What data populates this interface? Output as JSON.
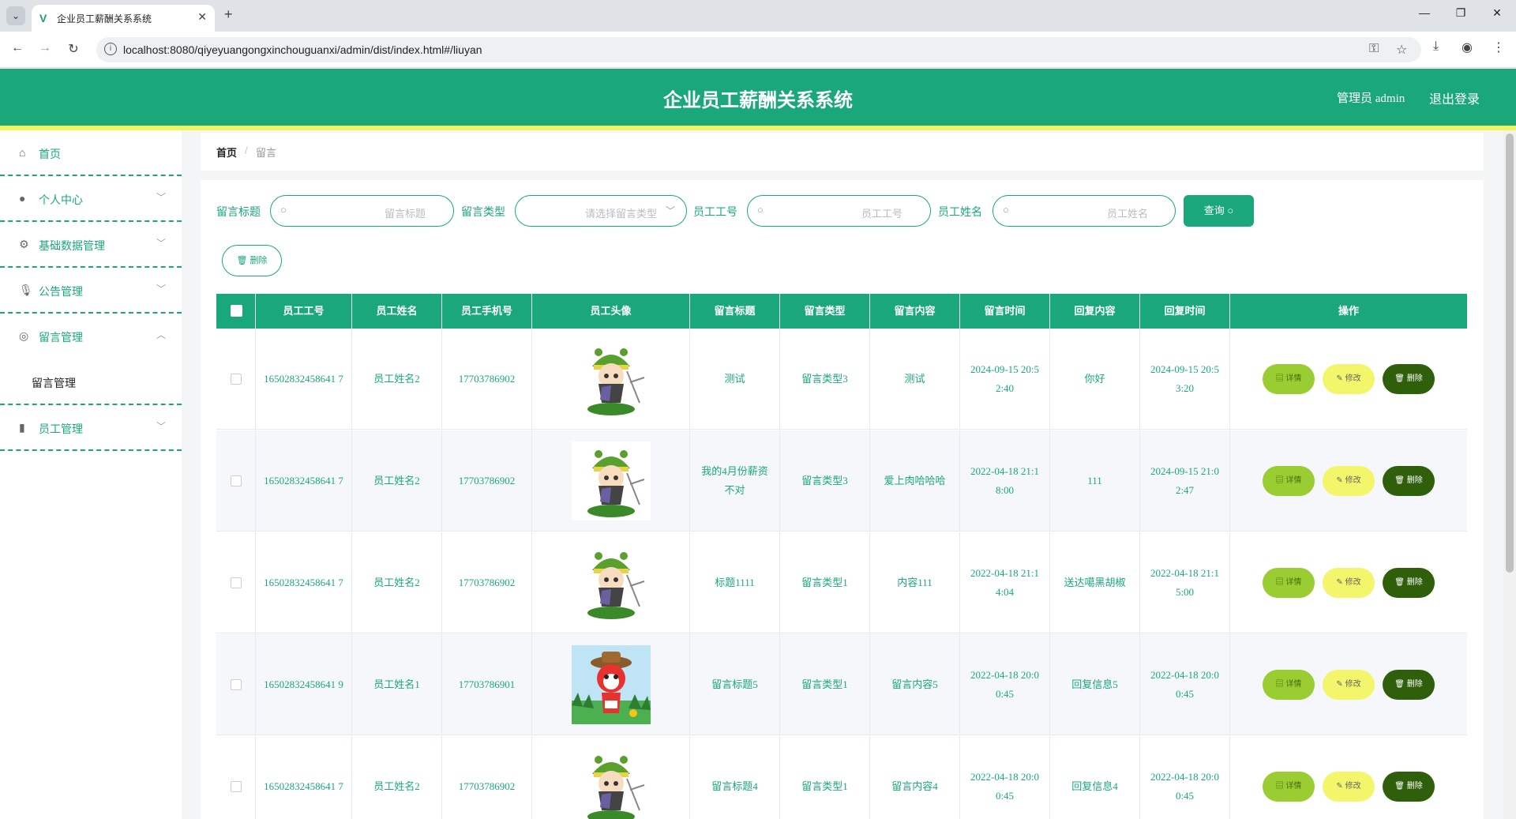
{
  "browser": {
    "tab_title": "企业员工薪酬关系系统",
    "url": "localhost:8080/qiyeyuangongxinchouguanxi/admin/dist/index.html#/liuyan"
  },
  "header": {
    "title": "企业员工薪酬关系系统",
    "user": "管理员 admin",
    "logout": "退出登录"
  },
  "sidebar": {
    "items": [
      {
        "label": "首页",
        "icon": "home-icon"
      },
      {
        "label": "个人中心",
        "icon": "user-icon"
      },
      {
        "label": "基础数据管理",
        "icon": "settings-icon"
      },
      {
        "label": "公告管理",
        "icon": "microphone-icon"
      },
      {
        "label": "留言管理",
        "icon": "compass-icon"
      },
      {
        "label": "员工管理",
        "icon": "bar-chart-icon"
      }
    ],
    "sub_item": "留言管理"
  },
  "breadcrumb": {
    "home": "首页",
    "sep": "/",
    "current": "留言"
  },
  "filters": {
    "title_label": "留言标题",
    "title_ph": "留言标题",
    "type_label": "留言类型",
    "type_ph": "请选择留言类型",
    "no_label": "员工工号",
    "no_ph": "员工工号",
    "name_label": "员工姓名",
    "name_ph": "员工姓名",
    "query": "查询",
    "delete": "删除"
  },
  "table": {
    "headers": [
      "员工工号",
      "员工姓名",
      "员工手机号",
      "员工头像",
      "留言标题",
      "留言类型",
      "留言内容",
      "留言时间",
      "回复内容",
      "回复时间",
      "操作"
    ],
    "actions": {
      "detail": "详情",
      "edit": "修改",
      "delete": "删除"
    },
    "rows": [
      {
        "no": "16502832458641 7",
        "name": "员工姓名2",
        "phone": "17703786902",
        "avatar": "green",
        "title": "测试",
        "type": "留言类型3",
        "content": "测试",
        "time": "2024-09-15 20:52:40",
        "reply": "你好",
        "reply_time": "2024-09-15 20:53:20"
      },
      {
        "no": "16502832458641 7",
        "name": "员工姓名2",
        "phone": "17703786902",
        "avatar": "green",
        "title": "我的4月份薪资不对",
        "type": "留言类型3",
        "content": "爱上肉哈哈哈",
        "time": "2022-04-18 21:18:00",
        "reply": "111",
        "reply_time": "2024-09-15 21:02:47"
      },
      {
        "no": "16502832458641 7",
        "name": "员工姓名2",
        "phone": "17703786902",
        "avatar": "green",
        "title": "标题1111",
        "type": "留言类型1",
        "content": "内容111",
        "time": "2022-04-18 21:14:04",
        "reply": "送达噶黑胡椒",
        "reply_time": "2022-04-18 21:15:00"
      },
      {
        "no": "16502832458641 9",
        "name": "员工姓名1",
        "phone": "17703786901",
        "avatar": "red",
        "title": "留言标题5",
        "type": "留言类型1",
        "content": "留言内容5",
        "time": "2022-04-18 20:00:45",
        "reply": "回复信息5",
        "reply_time": "2022-04-18 20:00:45"
      },
      {
        "no": "16502832458641 7",
        "name": "员工姓名2",
        "phone": "17703786902",
        "avatar": "green",
        "title": "留言标题4",
        "type": "留言类型1",
        "content": "留言内容4",
        "time": "2022-04-18 20:00:45",
        "reply": "回复信息4",
        "reply_time": "2022-04-18 20:00:45"
      }
    ]
  },
  "colors": {
    "primary": "#1aa87b",
    "stripe": "#f1f45a",
    "detail": "#9acd32",
    "edit": "#f3f56a",
    "delete": "#2f5f0a"
  }
}
